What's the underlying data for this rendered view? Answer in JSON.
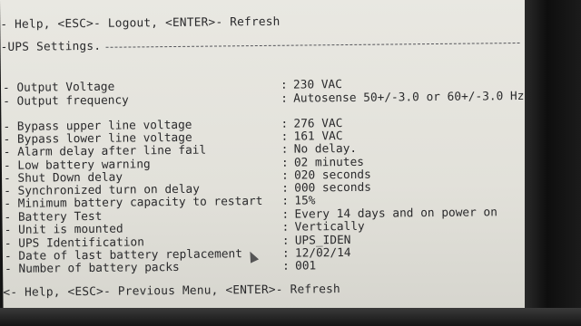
{
  "header": {
    "help_line": "- Help, <ESC>- Logout, <ENTER>- Refresh"
  },
  "section": {
    "title": "-UPS Settings."
  },
  "output": [
    {
      "label": "- Output Voltage",
      "value": "230 VAC"
    },
    {
      "label": "- Output frequency",
      "value": "Autosense 50+/-3.0 or 60+/-3.0 Hz"
    }
  ],
  "settings": [
    {
      "label": "- Bypass upper line voltage",
      "value": "276 VAC"
    },
    {
      "label": "- Bypass lower line voltage",
      "value": "161 VAC"
    },
    {
      "label": "- Alarm delay after line fail",
      "value": "No delay."
    },
    {
      "label": "- Low battery warning",
      "value": "02 minutes"
    },
    {
      "label": "- Shut Down delay",
      "value": "020 seconds"
    },
    {
      "label": "- Synchronized turn on delay",
      "value": "000 seconds"
    },
    {
      "label": "- Minimum battery capacity to restart",
      "value": "15%"
    },
    {
      "label": "- Battery Test",
      "value": "Every 14 days and on power on"
    },
    {
      "label": "- Unit is mounted",
      "value": "Vertically"
    },
    {
      "label": "- UPS Identification",
      "value": "UPS_IDEN"
    },
    {
      "label": "- Date of last battery replacement",
      "value": "12/02/14"
    },
    {
      "label": "- Number of battery packs",
      "value": "001"
    }
  ],
  "footer": {
    "help_line": "<- Help, <ESC>- Previous Menu, <ENTER>- Refresh"
  }
}
